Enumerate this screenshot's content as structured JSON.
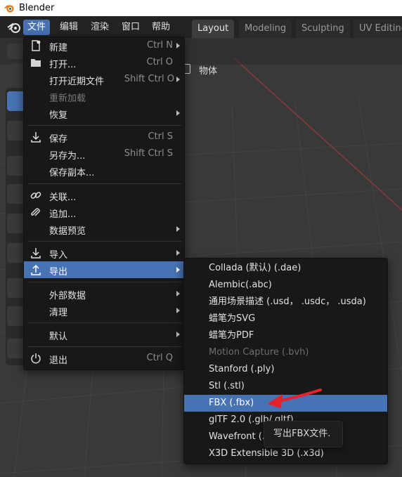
{
  "window": {
    "title": "Blender"
  },
  "menubar": {
    "items": [
      {
        "label": "文件",
        "active": true
      },
      {
        "label": "编辑"
      },
      {
        "label": "渲染"
      },
      {
        "label": "窗口"
      },
      {
        "label": "帮助"
      }
    ]
  },
  "workspace_tabs": [
    {
      "label": "Layout",
      "active": true
    },
    {
      "label": "Modeling"
    },
    {
      "label": "Sculpting"
    },
    {
      "label": "UV Editing"
    }
  ],
  "viewport": {
    "object_menu_label": "物体"
  },
  "file_menu": {
    "items": [
      {
        "label": "新建",
        "shortcut": "Ctrl N",
        "submenu": true,
        "icon": "new-file-icon"
      },
      {
        "label": "打开...",
        "shortcut": "Ctrl O",
        "icon": "folder-icon"
      },
      {
        "label": "打开近期文件",
        "shortcut": "Shift Ctrl O",
        "submenu": true
      },
      {
        "label": "重新加载",
        "disabled": true
      },
      {
        "label": "恢复",
        "submenu": true
      },
      {
        "label": "保存",
        "shortcut": "Ctrl S",
        "icon": "save-icon"
      },
      {
        "label": "另存为...",
        "shortcut": "Shift Ctrl S"
      },
      {
        "label": "保存副本..."
      },
      {
        "label": "关联...",
        "icon": "link-icon"
      },
      {
        "label": "追加...",
        "icon": "append-icon"
      },
      {
        "label": "数据预览",
        "submenu": true
      },
      {
        "label": "导入",
        "submenu": true,
        "icon": "import-icon"
      },
      {
        "label": "导出",
        "submenu": true,
        "icon": "export-icon",
        "highlight": true
      },
      {
        "label": "外部数据",
        "submenu": true
      },
      {
        "label": "清理",
        "submenu": true
      },
      {
        "label": "默认",
        "submenu": true
      },
      {
        "label": "退出",
        "shortcut": "Ctrl Q",
        "icon": "power-icon"
      }
    ]
  },
  "export_submenu": {
    "items": [
      {
        "label": "Collada (默认) (.dae)"
      },
      {
        "label": "Alembic(.abc)"
      },
      {
        "label": "通用场景描述 (.usd， .usdc， .usda)"
      },
      {
        "label": "蜡笔为SVG"
      },
      {
        "label": "蜡笔为PDF"
      },
      {
        "label": "Motion Capture (.bvh)",
        "disabled": true
      },
      {
        "label": "Stanford (.ply)"
      },
      {
        "label": "Stl (.stl)"
      },
      {
        "label": "FBX (.fbx)",
        "highlight": true
      },
      {
        "label": "glTF 2.0 (.glb/.gltf)"
      },
      {
        "label": "Wavefront (.obj)"
      },
      {
        "label": "X3D Extensible 3D (.x3d)"
      }
    ]
  },
  "tooltip": {
    "text": "写出FBX文件."
  },
  "colors": {
    "accent": "#4772b3",
    "annotation_arrow": "#e8202a",
    "menu_bg": "#181818",
    "topbar_bg": "#232323"
  }
}
